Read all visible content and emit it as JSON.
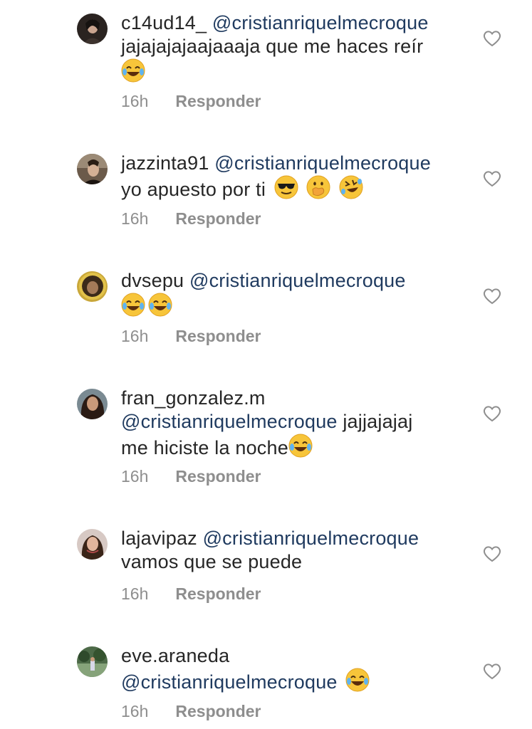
{
  "comments": [
    {
      "username": "c14ud14_",
      "mention": "@cristianriquelmecroque",
      "text_inline": "",
      "text": "jajajajajaajaaaja que me haces reír",
      "emojis": [
        "joy-emoji"
      ],
      "time": "16h",
      "reply_label": "Responder"
    },
    {
      "username": "jazzinta91",
      "mention": "@cristianriquelmecroque",
      "text_inline": "",
      "text": "yo apuesto por ti",
      "emojis": [
        "sunglasses-emoji",
        "hand-over-mouth-emoji",
        "rofl-emoji"
      ],
      "time": "16h",
      "reply_label": "Responder"
    },
    {
      "username": "dvsepu",
      "mention": "@cristianriquelmecroque",
      "text_inline": "",
      "text": "",
      "emojis": [
        "joy-emoji",
        "joy-emoji"
      ],
      "time": "16h",
      "reply_label": "Responder"
    },
    {
      "username": "fran_gonzalez.m",
      "mention": "@cristianriquelmecroque",
      "text_inline": " jajjajajaj",
      "text": "me hiciste la noche",
      "emojis": [
        "joy-emoji"
      ],
      "time": "16h",
      "reply_label": "Responder"
    },
    {
      "username": "lajavipaz",
      "mention": "@cristianriquelmecroque",
      "text_inline": "",
      "text": "vamos que se puede",
      "emojis": [],
      "time": "16h",
      "reply_label": "Responder"
    },
    {
      "username": "eve.araneda",
      "mention": "@cristianriquelmecroque",
      "text_inline": "",
      "text": "",
      "emojis": [
        "joy-emoji"
      ],
      "time": "16h",
      "reply_label": "Responder"
    }
  ]
}
